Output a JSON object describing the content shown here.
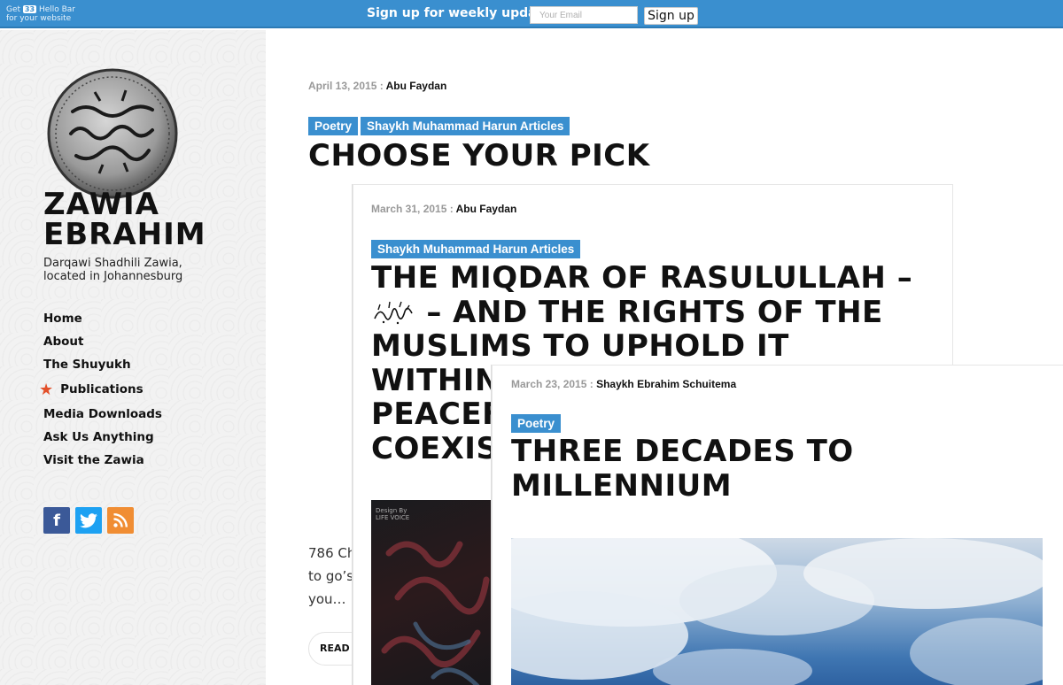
{
  "hellobar": {
    "brand_line1_prefix": "Get",
    "brand_badge": "33",
    "brand_line1_suffix": "Hello Bar",
    "brand_line2": "for your website",
    "message": "Sign up for weekly updates:",
    "email_placeholder": "Your Email",
    "signup_label": "Sign up"
  },
  "sidebar": {
    "title_line1": "ZAWIA",
    "title_line2": "EBRAHIM",
    "tagline": "Darqawi Shadhili Zawia, located in Johannesburg",
    "nav": [
      {
        "label": "Home"
      },
      {
        "label": "About"
      },
      {
        "label": "The Shuyukh"
      },
      {
        "label": "Publications",
        "icon": "star-icon"
      },
      {
        "label": "Media Downloads"
      },
      {
        "label": "Ask Us Anything"
      },
      {
        "label": "Visit the Zawia"
      }
    ],
    "socials": [
      {
        "name": "facebook-icon",
        "glyph": "f",
        "color": "#3b5998"
      },
      {
        "name": "twitter-icon",
        "glyph": "t",
        "color": "#1da1f2"
      },
      {
        "name": "rss-icon",
        "glyph": "◉",
        "color": "#f08d33"
      }
    ]
  },
  "posts": [
    {
      "date": "April 13, 2015",
      "separator": " : ",
      "author": "Abu Faydan",
      "tags": [
        "Poetry",
        "Shaykh Muhammad Harun Articles"
      ],
      "title": "CHOOSE YOUR PICK",
      "excerpt": [
        "786 Ch",
        "to go’s",
        "you…"
      ],
      "read_more": "READ O"
    },
    {
      "date": "March 31, 2015",
      "separator": " : ",
      "author": "Abu Faydan",
      "tags": [
        "Shaykh Muhammad Harun Articles"
      ],
      "title_part1": "THE MIQDAR OF RASULULLAH –",
      "title_part2": "– AND THE RIGHTS OF THE",
      "title_part3": "MUSLIMS TO UPHOLD IT",
      "title_part4": "WITHIN",
      "title_part5": "PEACEF",
      "title_part6": "COEXIS",
      "image_text": "Design By\nLIFE VOICE"
    },
    {
      "date": "March 23, 2015",
      "separator": " : ",
      "author": "Shaykh Ebrahim Schuitema",
      "tags": [
        "Poetry"
      ],
      "title_line1": "THREE DECADES TO",
      "title_line2": "MILLENNIUM"
    }
  ],
  "colors": {
    "accent": "#3a8fcf",
    "star": "#e3502a"
  }
}
